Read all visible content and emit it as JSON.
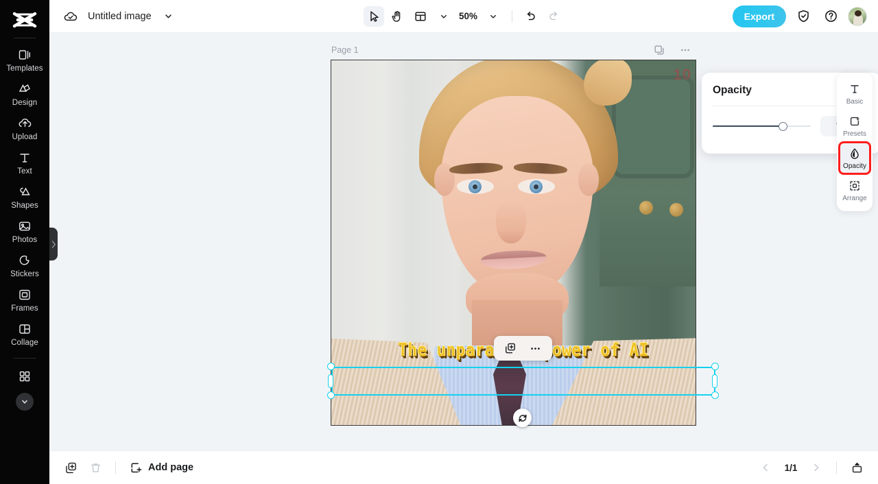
{
  "app": {
    "name": "CapCut Image Editor"
  },
  "topbar": {
    "cloud_icon": "cloud-check-icon",
    "document_title": "Untitled image",
    "title_chevron": "chevron-down-icon",
    "tools": [
      {
        "name": "select-tool",
        "icon": "cursor-arrow-icon",
        "active": true
      },
      {
        "name": "hand-tool",
        "icon": "hand-icon",
        "active": false
      },
      {
        "name": "layout-tool",
        "icon": "layout-grid-icon",
        "active": false
      }
    ],
    "layout_chevron": "chevron-down-icon",
    "zoom_level": "50%",
    "zoom_chevron": "chevron-down-icon",
    "undo_icon": "undo-arrow-icon",
    "redo_icon": "redo-arrow-icon",
    "export_label": "Export",
    "shield_icon": "shield-check-icon",
    "help_icon": "question-circle-icon",
    "avatar": "user-avatar"
  },
  "sidebar": {
    "logo": "capcut-logo",
    "items": [
      {
        "label": "Templates",
        "icon": "templates-icon"
      },
      {
        "label": "Design",
        "icon": "design-icon"
      },
      {
        "label": "Upload",
        "icon": "upload-cloud-icon"
      },
      {
        "label": "Text",
        "icon": "text-t-icon"
      },
      {
        "label": "Shapes",
        "icon": "shapes-icon"
      },
      {
        "label": "Photos",
        "icon": "photo-icon"
      },
      {
        "label": "Stickers",
        "icon": "sticker-icon"
      },
      {
        "label": "Frames",
        "icon": "frames-icon"
      },
      {
        "label": "Collage",
        "icon": "collage-icon"
      }
    ],
    "more_icon": "grid-apps-icon",
    "expand_icon": "chevron-down-icon",
    "collapse_handle_icon": "chevron-right-icon"
  },
  "canvas": {
    "page_label": "Page 1",
    "duplicate_icon": "duplicate-page-icon",
    "more_icon": "ellipsis-icon",
    "text_element": {
      "content": "The unparalled power of AI",
      "color": "#f0c222",
      "outline_color": "#6b4404",
      "selected": true
    },
    "floating_toolbar": {
      "duplicate_icon": "duplicate-add-icon",
      "more_icon": "ellipsis-icon"
    },
    "rotate_icon": "rotate-icon",
    "selection_color": "#13d2ef"
  },
  "opacity_panel": {
    "title": "Opacity",
    "close_icon": "close-x-icon",
    "value": "72%",
    "slider_percent": 72
  },
  "right_tools": {
    "items": [
      {
        "label": "Basic",
        "icon": "text-t-icon",
        "selected": false,
        "highlighted": false
      },
      {
        "label": "Presets",
        "icon": "presets-star-icon",
        "selected": false,
        "highlighted": false
      },
      {
        "label": "Opacity",
        "icon": "opacity-drop-icon",
        "selected": true,
        "highlighted": true
      },
      {
        "label": "Arrange",
        "icon": "arrange-icon",
        "selected": false,
        "highlighted": false
      }
    ],
    "highlight_color": "#ff1d1d"
  },
  "bottombar": {
    "duplicate_icon": "duplicate-add-icon",
    "delete_icon": "trash-icon",
    "add_page_label": "Add page",
    "add_page_icon": "add-page-icon",
    "prev_icon": "chevron-left-icon",
    "page_count": "1/1",
    "next_icon": "chevron-right-icon",
    "present_icon": "present-icon"
  }
}
